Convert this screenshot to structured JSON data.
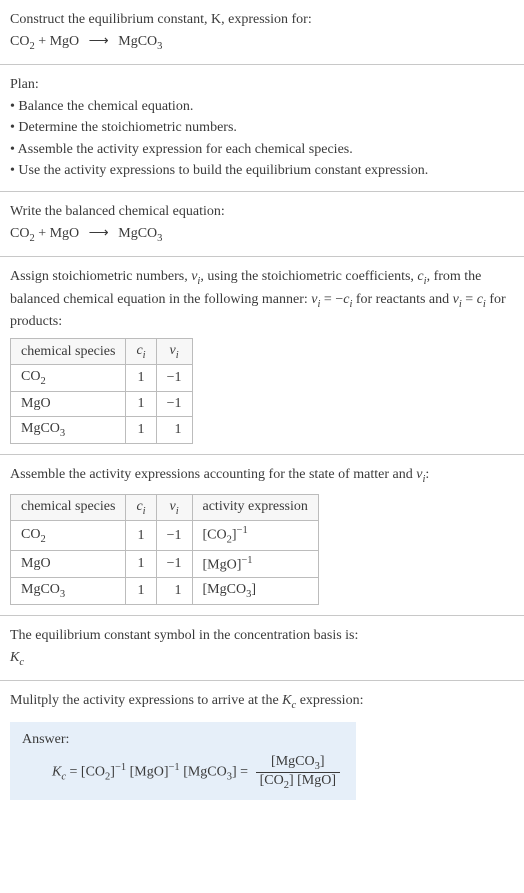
{
  "header": {
    "construct": "Construct the equilibrium constant, K, expression for:",
    "equation_lhs1": "CO",
    "equation_lhs1_sub": "2",
    "equation_plus": " + MgO ",
    "equation_arrow": "⟶",
    "equation_rhs": " MgCO",
    "equation_rhs_sub": "3"
  },
  "plan": {
    "title": "Plan:",
    "b1": "• Balance the chemical equation.",
    "b2": "• Determine the stoichiometric numbers.",
    "b3": "• Assemble the activity expression for each chemical species.",
    "b4": "• Use the activity expressions to build the equilibrium constant expression."
  },
  "balanced": {
    "title": "Write the balanced chemical equation:",
    "lhs1": "CO",
    "lhs1_sub": "2",
    "plus": " + MgO ",
    "arrow": "⟶",
    "rhs": " MgCO",
    "rhs_sub": "3"
  },
  "stoich": {
    "p1a": "Assign stoichiometric numbers, ",
    "p1b": "ν",
    "p1b_sub": "i",
    "p1c": ", using the stoichiometric coefficients, ",
    "p1d": "c",
    "p1d_sub": "i",
    "p1e": ", from the balanced chemical equation in the following manner: ",
    "p1f": "ν",
    "p1f_sub": "i",
    "p1g": " = −",
    "p1h": "c",
    "p1h_sub": "i",
    "p1i": " for reactants and ",
    "p1j": "ν",
    "p1j_sub": "i",
    "p1k": " = ",
    "p1l": "c",
    "p1l_sub": "i",
    "p1m": " for products:",
    "h_species": "chemical species",
    "h_ci": "c",
    "h_ci_sub": "i",
    "h_vi": "ν",
    "h_vi_sub": "i",
    "r1_sp": "CO",
    "r1_sp_sub": "2",
    "r1_ci": "1",
    "r1_vi": "−1",
    "r2_sp": "MgO",
    "r2_ci": "1",
    "r2_vi": "−1",
    "r3_sp": "MgCO",
    "r3_sp_sub": "3",
    "r3_ci": "1",
    "r3_vi": "1"
  },
  "activity": {
    "title_a": "Assemble the activity expressions accounting for the state of matter and ",
    "title_b": "ν",
    "title_b_sub": "i",
    "title_c": ":",
    "h_species": "chemical species",
    "h_ci": "c",
    "h_ci_sub": "i",
    "h_vi": "ν",
    "h_vi_sub": "i",
    "h_ae": "activity expression",
    "r1_sp": "CO",
    "r1_sp_sub": "2",
    "r1_ci": "1",
    "r1_vi": "−1",
    "r1_ae_a": "[CO",
    "r1_ae_sub": "2",
    "r1_ae_b": "]",
    "r1_ae_sup": "−1",
    "r2_sp": "MgO",
    "r2_ci": "1",
    "r2_vi": "−1",
    "r2_ae_a": "[MgO]",
    "r2_ae_sup": "−1",
    "r3_sp": "MgCO",
    "r3_sp_sub": "3",
    "r3_ci": "1",
    "r3_vi": "1",
    "r3_ae_a": "[MgCO",
    "r3_ae_sub": "3",
    "r3_ae_b": "]"
  },
  "symbol": {
    "title": "The equilibrium constant symbol in the concentration basis is:",
    "val": "K",
    "val_sub": "c"
  },
  "multiply": {
    "title_a": "Mulitply the activity expressions to arrive at the ",
    "title_b": "K",
    "title_b_sub": "c",
    "title_c": " expression:"
  },
  "answer": {
    "label": "Answer:",
    "kc": "K",
    "kc_sub": "c",
    "eq": " = [CO",
    "co2_sub": "2",
    "b1": "]",
    "sup1": "−1",
    "sp1": " [MgO]",
    "sup2": "−1",
    "sp2": " [MgCO",
    "mgco3_sub": "3",
    "b2": "] = ",
    "num_a": "[MgCO",
    "num_sub": "3",
    "num_b": "]",
    "den_a": "[CO",
    "den_sub": "2",
    "den_b": "] [MgO]"
  }
}
